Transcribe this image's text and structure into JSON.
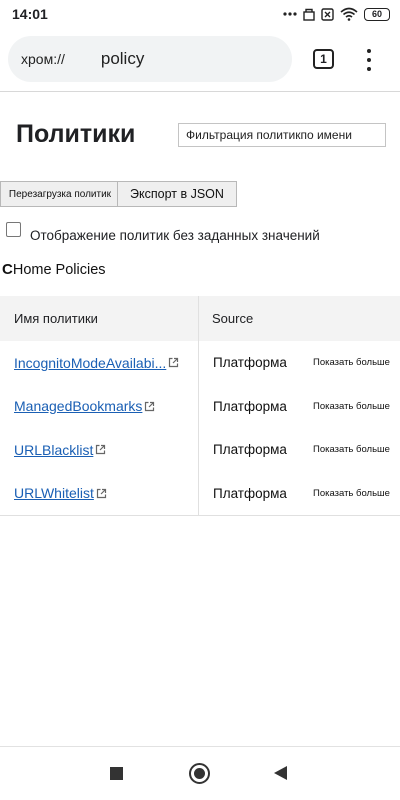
{
  "status_bar": {
    "time": "14:01",
    "icons": [
      "more-dots-icon",
      "recorder-icon",
      "no-sim-icon",
      "wifi-icon",
      "battery-icon"
    ],
    "battery_level": "60"
  },
  "address_bar": {
    "scheme": "хром://",
    "path": "policy",
    "tab_count": "1",
    "menu_icon": "overflow-menu-icon"
  },
  "page": {
    "title": "Политики",
    "filter_placeholder": "Фильтрация политикпо имени",
    "reload_button": "Перезагрузка политик",
    "export_button": "Экспорт в JSON",
    "show_unset_label": "Отображение политик без заданных значений",
    "show_unset_checked": false,
    "section_initial": "C",
    "section_title": "Home Policies"
  },
  "table": {
    "headers": {
      "name": "Имя политики",
      "source": "Source"
    },
    "rows": [
      {
        "name": "IncognitoModeAvailabi...",
        "source": "Платформа",
        "more": "Показать больше"
      },
      {
        "name": "ManagedBookmarks",
        "source": "Платформа",
        "more": "Показать больше"
      },
      {
        "name": "URLBlacklist",
        "source": "Платформа",
        "more": "Показать больше"
      },
      {
        "name": "URLWhitelist",
        "source": "Платформа",
        "more": "Показать больше"
      }
    ]
  },
  "nav_bar": {
    "buttons": [
      "recents-icon",
      "home-icon",
      "back-icon"
    ]
  },
  "colors": {
    "link": "#1a5fb4",
    "header_bg": "#f3f3f3",
    "omnibox_bg": "#f1f3f4"
  }
}
